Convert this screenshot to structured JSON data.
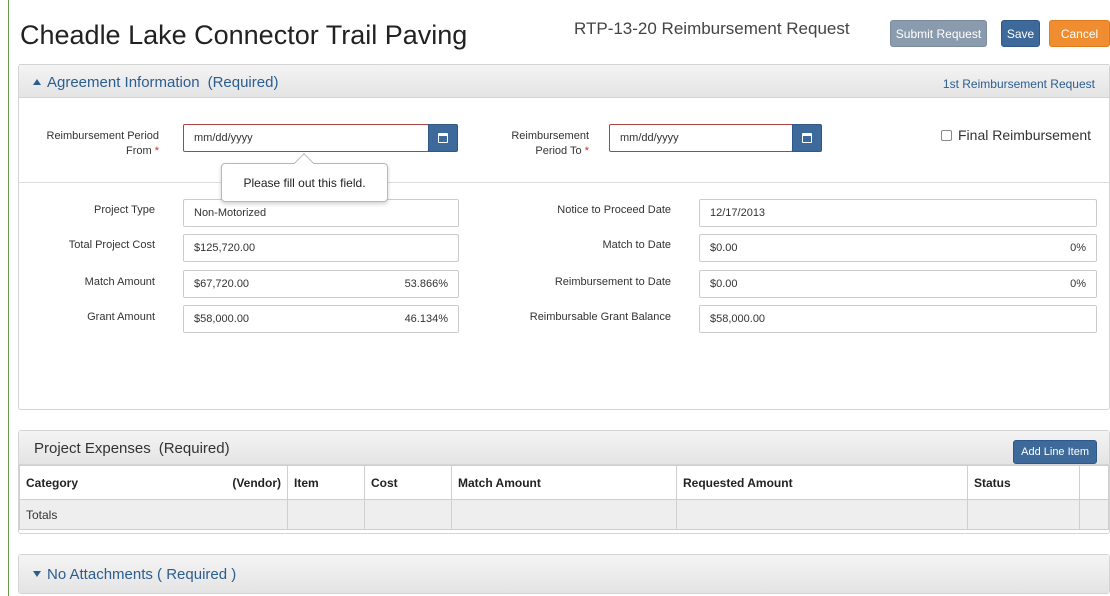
{
  "header": {
    "title": "Cheadle Lake Connector Trail Paving",
    "subtitle": "RTP-13-20  Reimbursement Request",
    "buttons": {
      "submit": "Submit Request",
      "save": "Save",
      "cancel": "Cancel"
    }
  },
  "agreement": {
    "title": "Agreement Information",
    "required": "(Required)",
    "request_number": "1st Reimbursement Request",
    "period_from": {
      "label_line1": "Reimbursement Period",
      "label_line2": "From",
      "placeholder": "mm/dd/yyyy"
    },
    "period_to": {
      "label_line1": "Reimbursement",
      "label_line2": "Period To",
      "placeholder": "mm/dd/yyyy"
    },
    "final_reimbursement": {
      "label": "Final Reimbursement",
      "checked": false
    },
    "tooltip": "Please fill out this field.",
    "left_fields": [
      {
        "label": "Project Type",
        "value": "Non-Motorized",
        "pct": ""
      },
      {
        "label": "Total Project Cost",
        "value": "$125,720.00",
        "pct": ""
      },
      {
        "label": "Match Amount",
        "value": "$67,720.00",
        "pct": "53.866%"
      },
      {
        "label": "Grant Amount",
        "value": "$58,000.00",
        "pct": "46.134%"
      }
    ],
    "right_fields": [
      {
        "label": "Notice to Proceed Date",
        "value": "12/17/2013",
        "pct": ""
      },
      {
        "label": "Match to Date",
        "value": "$0.00",
        "pct": "0%"
      },
      {
        "label": "Reimbursement to Date",
        "value": "$0.00",
        "pct": "0%"
      },
      {
        "label": "Reimbursable Grant Balance",
        "value": "$58,000.00",
        "pct": ""
      }
    ]
  },
  "expenses": {
    "title": "Project Expenses",
    "required": "(Required)",
    "add_button": "Add Line Item",
    "columns": {
      "category": "Category",
      "vendor": "(Vendor)",
      "item": "Item",
      "cost": "Cost",
      "match_amount": "Match Amount",
      "requested_amount": "Requested Amount",
      "status": "Status"
    },
    "totals_label": "Totals"
  },
  "attachments": {
    "title": "No Attachments ( Required )"
  },
  "colors": {
    "primary_button": "#3d6a9b",
    "submit_button": "#8a9bad",
    "cancel_button": "#ef8d30",
    "link_blue": "#2c5d8f",
    "required_star": "#c9302c",
    "invalid_border": "#a94442"
  },
  "icons": {
    "calendar": "calendar-icon",
    "caret_up": "caret-up-icon",
    "caret_down": "caret-down-icon"
  }
}
